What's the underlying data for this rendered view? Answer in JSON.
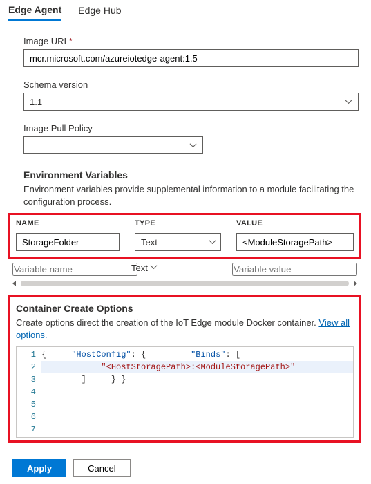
{
  "tabs": {
    "edge_agent": "Edge Agent",
    "edge_hub": "Edge Hub"
  },
  "fields": {
    "image_uri_label": "Image URI",
    "required_mark": "*",
    "image_uri_value": "mcr.microsoft.com/azureiotedge-agent:1.5",
    "schema_label": "Schema version",
    "schema_value": "1.1",
    "pull_label": "Image Pull Policy",
    "pull_value": ""
  },
  "env": {
    "title": "Environment Variables",
    "desc": "Environment variables provide supplemental information to a module facilitating the configuration process.",
    "headers": {
      "name": "NAME",
      "type": "TYPE",
      "value": "VALUE"
    },
    "row1": {
      "name": "StorageFolder",
      "type": "Text",
      "value": "<ModuleStoragePath>"
    },
    "row2": {
      "name_ph": "Variable name",
      "type": "Text",
      "value_ph": "Variable value"
    }
  },
  "cco": {
    "title": "Container Create Options",
    "desc_pre": "Create options direct the creation of the IoT Edge module Docker container. ",
    "link": "View all options.",
    "code": {
      "l1": "{",
      "l2_key": "\"HostConfig\"",
      "l2_rest": ": {",
      "l3_key": "\"Binds\"",
      "l3_rest": ": [",
      "l4": "\"<HostStoragePath>:<ModuleStoragePath>\"",
      "l5": "]",
      "l6": "}",
      "l7": "}"
    }
  },
  "footer": {
    "apply": "Apply",
    "cancel": "Cancel"
  }
}
